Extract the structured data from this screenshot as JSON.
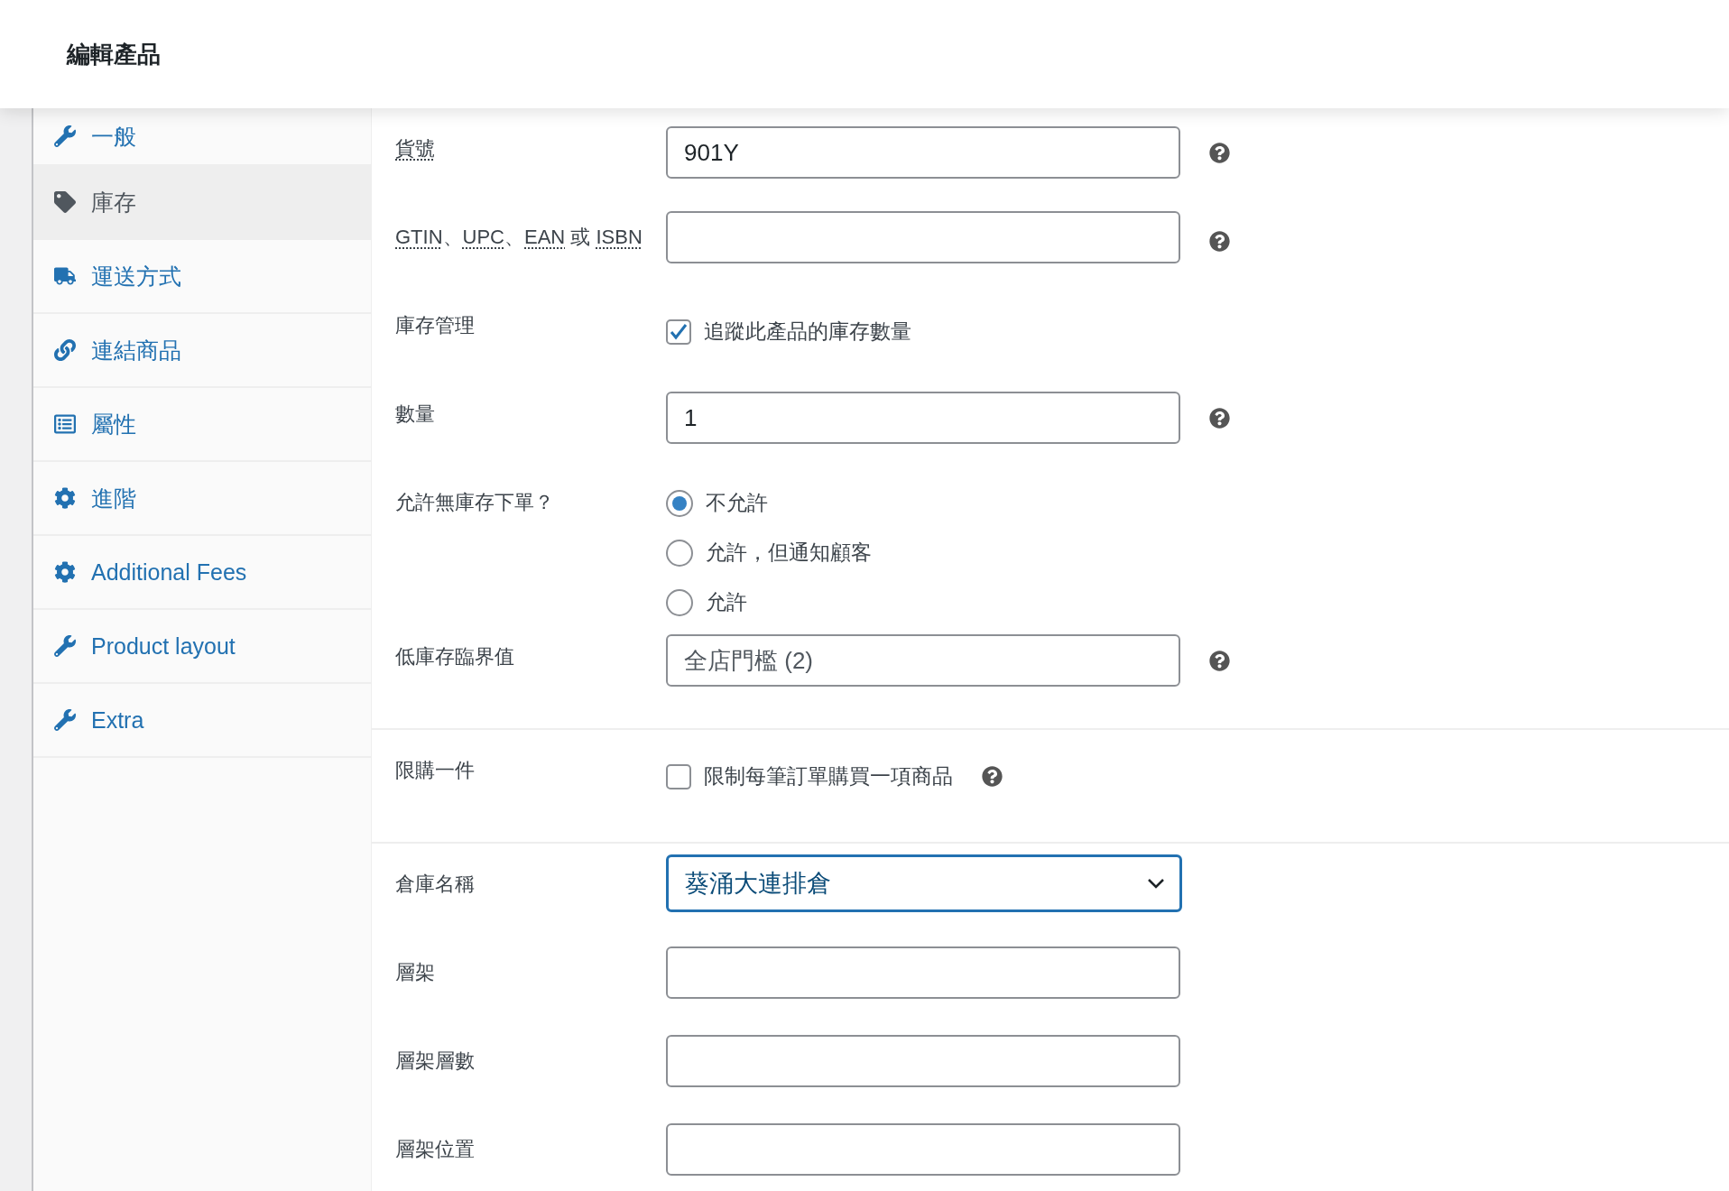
{
  "header": {
    "title": "編輯產品"
  },
  "sidebar": {
    "items": [
      {
        "label": "一般",
        "selected": false
      },
      {
        "label": "庫存",
        "selected": true
      },
      {
        "label": "運送方式",
        "selected": false
      },
      {
        "label": "連結商品",
        "selected": false
      },
      {
        "label": "屬性",
        "selected": false
      },
      {
        "label": "進階",
        "selected": false
      },
      {
        "label": "Additional Fees",
        "selected": false
      },
      {
        "label": "Product layout",
        "selected": false
      },
      {
        "label": "Extra",
        "selected": false
      }
    ]
  },
  "sections": [
    {
      "fields": [
        {
          "kind": "text",
          "label": [
            {
              "text": "貨號",
              "abbr": true
            }
          ],
          "value": "901Y",
          "help": true
        },
        {
          "kind": "text",
          "label": [
            {
              "text": "GTIN",
              "abbr": true
            },
            {
              "text": "、",
              "abbr": false
            },
            {
              "text": "UPC",
              "abbr": true
            },
            {
              "text": "、",
              "abbr": false
            },
            {
              "text": "EAN",
              "abbr": true
            },
            {
              "text": " 或 ",
              "abbr": false
            },
            {
              "text": "ISBN",
              "abbr": true
            }
          ],
          "help": true
        },
        {
          "kind": "checkbox",
          "label": [
            {
              "text": "庫存管理",
              "abbr": false
            }
          ],
          "option": "追蹤此產品的庫存數量",
          "checked": true,
          "help": false
        },
        {
          "kind": "text",
          "label": [
            {
              "text": "數量",
              "abbr": false
            }
          ],
          "value": "1",
          "help": true
        },
        {
          "kind": "radio",
          "label": [
            {
              "text": "允許無庫存下單？",
              "abbr": false
            }
          ],
          "options": [
            {
              "label": "不允許",
              "selected": true
            },
            {
              "label": "允許，但通知顧客",
              "selected": false
            },
            {
              "label": "允許",
              "selected": false
            }
          ],
          "help": false
        },
        {
          "kind": "text",
          "label": [
            {
              "text": "低庫存臨界值",
              "abbr": false
            }
          ],
          "placeholder": "全店門檻 (2)",
          "help": true
        }
      ]
    },
    {
      "fields": [
        {
          "kind": "checkbox",
          "label": [
            {
              "text": "限購一件",
              "abbr": false
            }
          ],
          "option": "限制每筆訂單購買一項商品",
          "checked": false,
          "help": true
        }
      ]
    },
    {
      "fields": [
        {
          "kind": "select",
          "label": [
            {
              "text": "倉庫名稱",
              "abbr": false
            }
          ],
          "value": "葵涌大連排倉",
          "focused": true,
          "help": false
        },
        {
          "kind": "text",
          "label": [
            {
              "text": "層架",
              "abbr": false
            }
          ],
          "help": false
        },
        {
          "kind": "text",
          "label": [
            {
              "text": "層架層數",
              "abbr": false
            }
          ],
          "help": false
        },
        {
          "kind": "text",
          "label": [
            {
              "text": "層架位置",
              "abbr": false
            }
          ],
          "help": false
        }
      ]
    }
  ]
}
